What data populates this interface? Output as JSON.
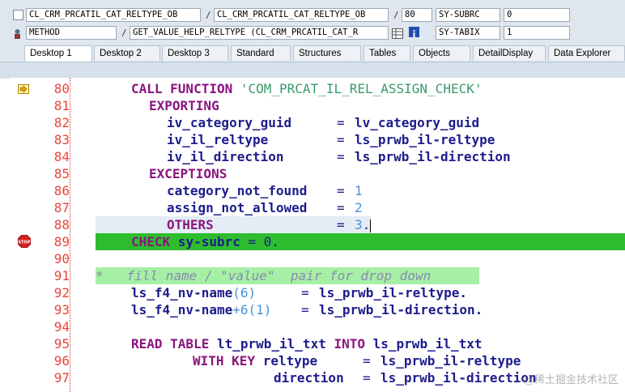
{
  "header": {
    "program": "CL_CRM_PRCATIL_CAT_RELTYPE_OB",
    "include": "CL_CRM_PRCATIL_CAT_RELTYPE_OB",
    "line_no": "80",
    "var1_name": "SY-SUBRC",
    "var1_value": "0",
    "event_type": "METHOD",
    "event_name": "GET_VALUE_HELP_RELTYPE (CL_CRM_PRCATIL_CAT_R",
    "var2_name": "SY-TABIX",
    "var2_value": "1"
  },
  "tabs": [
    {
      "label": "Desktop 1",
      "active": true
    },
    {
      "label": "Desktop 2"
    },
    {
      "label": "Desktop 3"
    },
    {
      "label": "Standard"
    },
    {
      "label": "Structures"
    },
    {
      "label": "Tables"
    },
    {
      "label": "Objects"
    },
    {
      "label": "DetailDisplay"
    },
    {
      "label": "Data Explorer"
    }
  ],
  "code_lines": [
    {
      "n": "80",
      "marker": "current-line-arrow"
    },
    {
      "n": "81"
    },
    {
      "n": "82"
    },
    {
      "n": "83"
    },
    {
      "n": "84"
    },
    {
      "n": "85"
    },
    {
      "n": "86"
    },
    {
      "n": "87"
    },
    {
      "n": "88"
    },
    {
      "n": "89",
      "marker": "breakpoint-stop"
    },
    {
      "n": "90"
    },
    {
      "n": "91"
    },
    {
      "n": "92"
    },
    {
      "n": "93"
    },
    {
      "n": "94"
    },
    {
      "n": "95"
    },
    {
      "n": "96"
    },
    {
      "n": "97"
    }
  ],
  "code": {
    "l80_kw": "CALL FUNCTION ",
    "l80_str": "'COM_PRCAT_IL_REL_ASSIGN_CHECK'",
    "l81_kw": "EXPORTING",
    "l82_var": "iv_category_guid",
    "l82_val": "lv_category_guid",
    "l83_var": "iv_il_reltype",
    "l83_val": "ls_prwb_il-reltype",
    "l84_var": "iv_il_direction",
    "l84_val": "ls_prwb_il-direction",
    "l85_kw": "EXCEPTIONS",
    "l86_var": "category_not_found",
    "l86_num": "1",
    "l87_var": "assign_not_allowed",
    "l87_num": "2",
    "l88_kw": "OTHERS",
    "l88_num": "3",
    "l89_kw": "CHECK",
    "l89_var": " sy-subrc ",
    "l89_rest": "= 0.",
    "l91_comment": "*   fill name / \"value\"  pair for drop down",
    "l92_var": "ls_f4_nv-name",
    "l92_paren": "(6)",
    "l92_val": "ls_prwb_il-reltype.",
    "l93_var": "ls_f4_nv-name",
    "l93_off": "+6(1)",
    "l93_val": "ls_prwb_il-direction.",
    "l95_kw1": "READ TABLE",
    "l95_var1": "lt_prwb_il_txt",
    "l95_kw2": "INTO",
    "l95_var2": "ls_prwb_il_txt",
    "l96_kw": "WITH KEY",
    "l96_var": "reltype",
    "l96_val": "ls_prwb_il-reltype",
    "l97_var": "direction",
    "l97_val": "ls_prwb_il-direction"
  },
  "watermark": "@稀土掘金技术社区",
  "colors": {
    "keyword": "#8a1580",
    "identifier": "#1c1c8c",
    "string": "#3a9a6a",
    "number": "#4a90d8",
    "line_number": "#e8453c",
    "current_line_bg": "#2ebd2e",
    "comment_bg": "#a6f0a6",
    "cursor_line_bg": "#e4edf5"
  }
}
